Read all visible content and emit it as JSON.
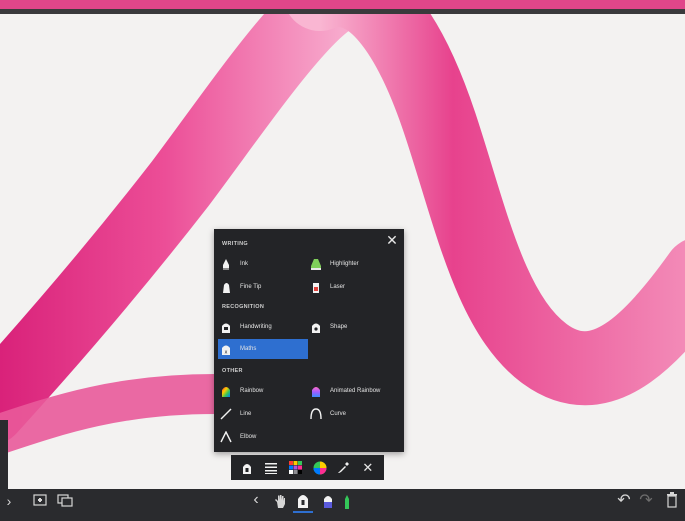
{
  "menu": {
    "close_glyph": "✕",
    "sections": {
      "writing": "WRITING",
      "recognition": "RECOGNITION",
      "other": "OTHER"
    },
    "items": {
      "ink": "Ink",
      "highlighter": "Highlighter",
      "fine_tip": "Fine Tip",
      "laser": "Laser",
      "handwriting": "Handwriting",
      "shape": "Shape",
      "maths": "Maths",
      "rainbow": "Rainbow",
      "animated_rainbow": "Animated Rainbow",
      "line": "Line",
      "curve": "Curve",
      "elbow": "Elbow"
    },
    "selected_item": "maths"
  },
  "toolbar": {
    "close_glyph": "✕",
    "icons": [
      "pen-icon",
      "lines-icon",
      "palette-grid-icon",
      "color-wheel-icon",
      "eyedropper-icon",
      "close-icon"
    ]
  },
  "bottom_bar": {
    "left_icons": [
      "chevron-right-icon",
      "add-page-icon",
      "pages-icon"
    ],
    "center_icons": [
      "chevron-left-icon",
      "hand-icon",
      "pen-icon",
      "highlighter-icon",
      "marker-icon"
    ],
    "right_icons": [
      "undo-icon",
      "redo-icon",
      "trash-icon"
    ],
    "chevron_left_glyph": "‹",
    "chevron_right_glyph": "›",
    "undo_glyph": "↶",
    "redo_glyph": "↷"
  },
  "colors": {
    "stroke_pink": "#e73c8c",
    "stroke_light": "#f6b3d1",
    "panel_bg": "#232427",
    "selected_bg": "#2e6fd0"
  }
}
